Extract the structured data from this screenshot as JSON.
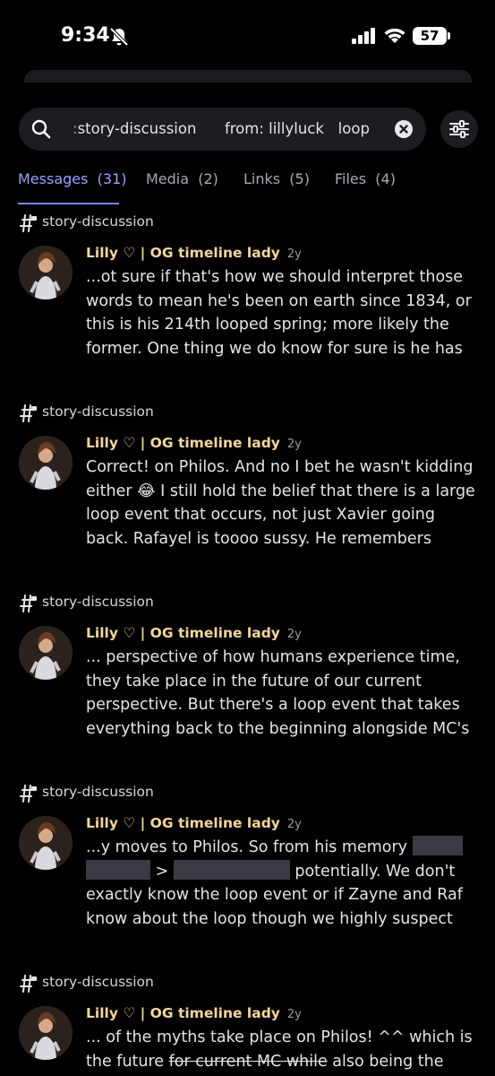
{
  "status_bar": {
    "time": "9:34",
    "battery": "57"
  },
  "search": {
    "faded_prefix": ":",
    "channel_filter": "story-discussion",
    "from_filter": "from: lillyluck",
    "query": "loop"
  },
  "tabs": [
    {
      "label": "Messages",
      "count": "(31)",
      "active": true
    },
    {
      "label": "Media",
      "count": "(2)"
    },
    {
      "label": "Links",
      "count": "(5)"
    },
    {
      "label": "Files",
      "count": "(4)"
    }
  ],
  "results": [
    {
      "channel": "story-discussion",
      "author": "Lilly ♡ | OG timeline lady",
      "timestamp": "2y",
      "text": "...ot sure if that's how we should interpret those words to mean he's been on earth since 1834, or this is his 214th looped spring; more likely the former. One thing we do know for sure is he has"
    },
    {
      "channel": "story-discussion",
      "author": "Lilly ♡ | OG timeline lady",
      "timestamp": "2y",
      "text_a": "Correct! on Philos. And no I bet he wasn't kidding either ",
      "emoji": "😂",
      "text_b": " I still hold the belief that there is a large loop event that occurs, not just Xavier going back. Rafayel is toooo sussy. He remembers"
    },
    {
      "channel": "story-discussion",
      "author": "Lilly ♡ | OG timeline lady",
      "timestamp": "2y",
      "text": "... perspective of how humans experience time, they take place in the future of our current perspective. But there's a loop event that takes everything back to the beginning alongside MC's"
    },
    {
      "channel": "story-discussion",
      "author": "Lilly ♡ | OG timeline lady",
      "timestamp": "2y",
      "text_a": "...y moves to Philos. So from his memory ",
      "text_b": " > ",
      "text_c": " potentially. We don't exactly know the loop event or if Zayne and Raf know about the loop though we highly suspect"
    },
    {
      "channel": "story-discussion",
      "author": "Lilly ♡ | OG timeline lady",
      "timestamp": "2y",
      "text_a": "... of the myths take place on Philos! ^^ which is the future ",
      "text_strike": "for current MC while",
      "text_b": " also being the"
    }
  ]
}
